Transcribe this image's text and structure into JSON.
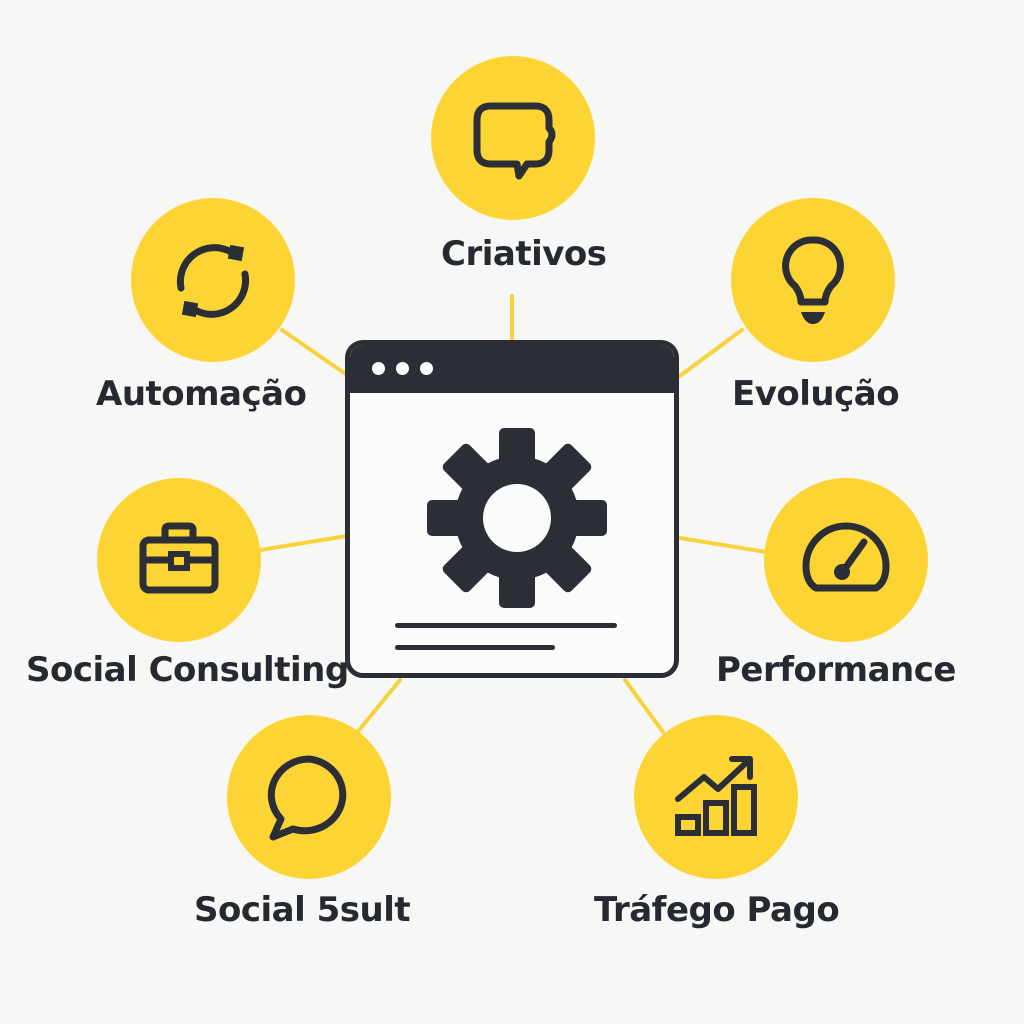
{
  "colors": {
    "background": "#f7f7f6",
    "node_fill": "#fcd535",
    "connector": "#f7d23c",
    "ink": "#2b2e34",
    "label_text": "#262a30"
  },
  "center": {
    "icon": "gear-icon",
    "window_controls": 3
  },
  "nodes": [
    {
      "id": "criativos",
      "label": "Criativos",
      "icon": "chat-bubble-icon"
    },
    {
      "id": "automacao",
      "label": "Automação",
      "icon": "refresh-cycle-icon"
    },
    {
      "id": "evolucao",
      "label": "Evolução",
      "icon": "lightbulb-icon"
    },
    {
      "id": "social-consulting",
      "label": "Social Consulting",
      "icon": "briefcase-icon"
    },
    {
      "id": "performance",
      "label": "Performance",
      "icon": "speedometer-icon"
    },
    {
      "id": "social-5sult",
      "label": "Social 5sult",
      "icon": "speech-bubble-icon"
    },
    {
      "id": "trafego-pago",
      "label": "Tráfego Pago",
      "icon": "growth-chart-icon"
    }
  ]
}
